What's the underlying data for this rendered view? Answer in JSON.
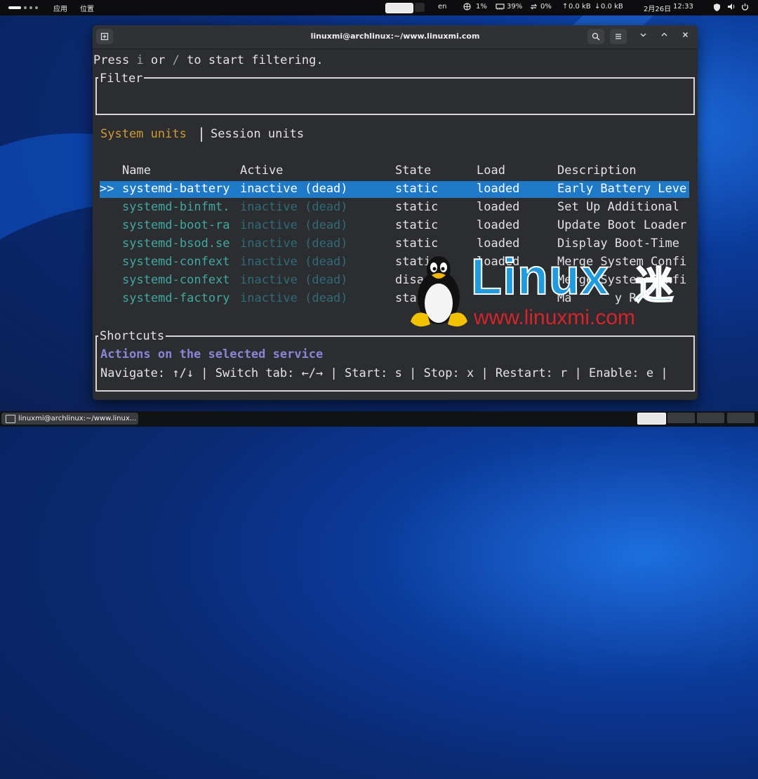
{
  "top_panel": {
    "apps_label": "应用",
    "places_label": "位置",
    "keyboard_layout": "en",
    "cpu": "1%",
    "memory": "39%",
    "swap": "0%",
    "net_up": "0.0 kB",
    "net_down": "0.0 kB",
    "date": "2月26日",
    "time": "12:33"
  },
  "window": {
    "title": "linuxmi@archlinux:~/www.linuxmi.com"
  },
  "terminal": {
    "hint": {
      "prefix": "Press ",
      "key1": "i",
      "middle": " or ",
      "key2": "/",
      "suffix": " to start filtering."
    },
    "filter_label": "Filter",
    "tabs": {
      "active": "System units",
      "separator": "|",
      "inactive": "Session units"
    },
    "columns": [
      "Name",
      "Active",
      "State",
      "Load",
      "Description"
    ],
    "selection_marker": ">>",
    "rows": [
      {
        "name": "systemd-battery",
        "active": "inactive (dead)",
        "state": "static",
        "load": "loaded",
        "description": "Early Battery Leve"
      },
      {
        "name": "systemd-binfmt.",
        "active": "inactive (dead)",
        "state": "static",
        "load": "loaded",
        "description": "Set Up Additional"
      },
      {
        "name": "systemd-boot-ra",
        "active": "inactive (dead)",
        "state": "static",
        "load": "loaded",
        "description": "Update Boot Loader"
      },
      {
        "name": "systemd-bsod.se",
        "active": "inactive (dead)",
        "state": "static",
        "load": "loaded",
        "description": "Display Boot-Time"
      },
      {
        "name": "systemd-confext",
        "active": "inactive (dead)",
        "state": "stati",
        "load": "loaded",
        "description": "Merge System Confi"
      },
      {
        "name": "systemd-confext",
        "active": "inactive (dead)",
        "state": "disa",
        "load": "",
        "description": "Merge System Confi"
      },
      {
        "name": "systemd-factory",
        "active": "inactive (dead)",
        "state": "sta",
        "load": "",
        "description": "Ma      y R"
      }
    ],
    "shortcuts_label": "Shortcuts",
    "shortcuts_heading": "Actions on the selected service",
    "shortcuts_line": "Navigate: ↑/↓ | Switch tab: ←/→ | Start: s | Stop: x | Restart: r | Enable: e |"
  },
  "watermark": {
    "word": "Linux",
    "cjk": "迷",
    "url": "www.linuxmi.com"
  },
  "taskbar": {
    "window_label": "linuxmi@archlinux:~/www.linux..."
  },
  "colors": {
    "selection": "#1e79c9",
    "tab_active": "#d39b2f",
    "unit_name": "#3fa9a0",
    "inactive_dim": "#2f6c78",
    "shortcut_heading": "#8c84d6",
    "logo_blue": "#1f9ce0",
    "logo_red": "#d8232a"
  }
}
